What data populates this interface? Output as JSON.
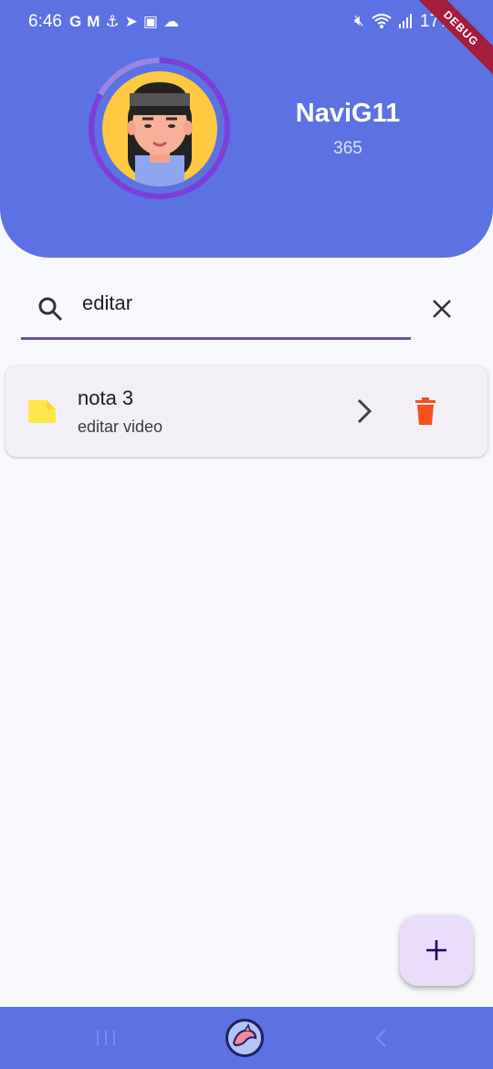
{
  "status_bar": {
    "time": "6:46",
    "left_icons": [
      "google-icon",
      "gmail-icon",
      "anchor-icon",
      "telegram-icon",
      "gallery-icon",
      "cloud-icon"
    ],
    "right_icons": [
      "mute-icon",
      "wifi-icon",
      "signal-icon"
    ],
    "battery": "17%"
  },
  "debug_banner": "DEBUG",
  "profile": {
    "name": "NaviG11",
    "score": "365",
    "ring_progress": 0.83
  },
  "search": {
    "value": "editar",
    "placeholder": ""
  },
  "notes": [
    {
      "title": "nota 3",
      "subtitle": "editar video",
      "icon_color": "#fde74c"
    }
  ],
  "colors": {
    "header": "#5c72e2",
    "accent": "#6b4fb0",
    "delete": "#f4511e",
    "fab": "#eaddfb"
  },
  "fab": {
    "icon": "plus-icon"
  },
  "nav": {
    "items": [
      "recents-icon",
      "home-dolphin-icon",
      "back-icon"
    ]
  }
}
